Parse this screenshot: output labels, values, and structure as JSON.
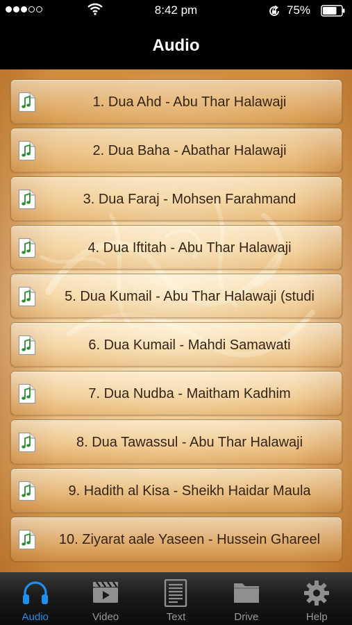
{
  "status_bar": {
    "time": "8:42 pm",
    "battery_percent": "75%",
    "battery_level": 0.75,
    "signal_dots_filled": 3,
    "signal_dots_total": 5
  },
  "nav": {
    "title": "Audio"
  },
  "tracks": [
    {
      "label": "1. Dua Ahd - Abu Thar Halawaji",
      "icon": "music-file-icon"
    },
    {
      "label": "2. Dua Baha - Abathar Halawaji",
      "icon": "music-file-icon"
    },
    {
      "label": "3. Dua Faraj - Mohsen Farahmand",
      "icon": "music-file-icon"
    },
    {
      "label": "4. Dua Iftitah - Abu Thar Halawaji",
      "icon": "music-file-icon"
    },
    {
      "label": "5. Dua Kumail - Abu Thar Halawaji (studi",
      "icon": "music-file-icon"
    },
    {
      "label": "6. Dua Kumail - Mahdi Samawati",
      "icon": "music-file-icon"
    },
    {
      "label": "7. Dua Nudba - Maitham Kadhim",
      "icon": "music-file-icon"
    },
    {
      "label": "8. Dua Tawassul - Abu Thar Halawaji",
      "icon": "music-file-icon"
    },
    {
      "label": "9. Hadith al Kisa - Sheikh Haidar Maula",
      "icon": "music-file-icon"
    },
    {
      "label": "10. Ziyarat aale Yaseen - Hussein Ghareel",
      "icon": "music-file-icon"
    }
  ],
  "tab_bar": {
    "active": "audio",
    "tabs": [
      {
        "id": "audio",
        "label": "Audio",
        "icon": "headphones-icon"
      },
      {
        "id": "video",
        "label": "Video",
        "icon": "film-icon"
      },
      {
        "id": "text",
        "label": "Text",
        "icon": "document-icon"
      },
      {
        "id": "drive",
        "label": "Drive",
        "icon": "folder-icon"
      },
      {
        "id": "help",
        "label": "Help",
        "icon": "gear-icon"
      }
    ]
  },
  "colors": {
    "accent": "#1f8ff0",
    "tab_inactive": "#9a9a9a",
    "track_text": "#352313",
    "music_icon_green": "#2e8b2e"
  }
}
